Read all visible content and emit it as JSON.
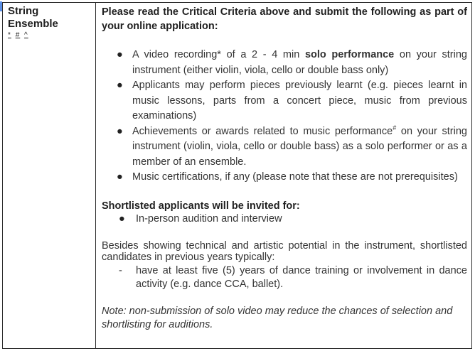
{
  "row": {
    "subject_line1": "String",
    "subject_line2": "Ensemble",
    "marks": [
      "*",
      "#",
      "^"
    ]
  },
  "content": {
    "intro": "Please read the Critical Criteria above and submit the following as part of your online application:",
    "bullet_glyph": "●",
    "bullets": {
      "b1_pre": "A video recording* of a 2 - 4 min ",
      "b1_bold": "solo performance",
      "b1_post": " on your string instrument (either violin, viola, cello or double bass only)",
      "b2": "Applicants may perform pieces previously learnt (e.g. pieces learnt in music lessons, parts from a concert piece, music from previous examinations)",
      "b3_pre": "Achievements or awards related to music performance",
      "b3_sup": "#",
      "b3_post": " on your string instrument (violin, viola, cello or double bass) as a solo performer or as a member of an ensemble.",
      "b4": "Music certifications, if any (please note that these are not prerequisites)"
    },
    "shortlist_heading": "Shortlisted applicants will be invited for:",
    "shortlist_item": "In-person audition and interview",
    "besides": "Besides showing technical and artistic potential in the instrument, shortlisted candidates in previous years typically:",
    "dash_glyph": "-",
    "dash_item": "have at least five (5) years of dance training or involvement in dance activity (e.g. dance CCA, ballet).",
    "note": "Note: non-submission of solo video may reduce the chances of selection and shortlisting for auditions."
  },
  "colors": {
    "border": "#2b2b2b",
    "corner_marker": "#4f86e0",
    "text": "#1f1f1f"
  }
}
